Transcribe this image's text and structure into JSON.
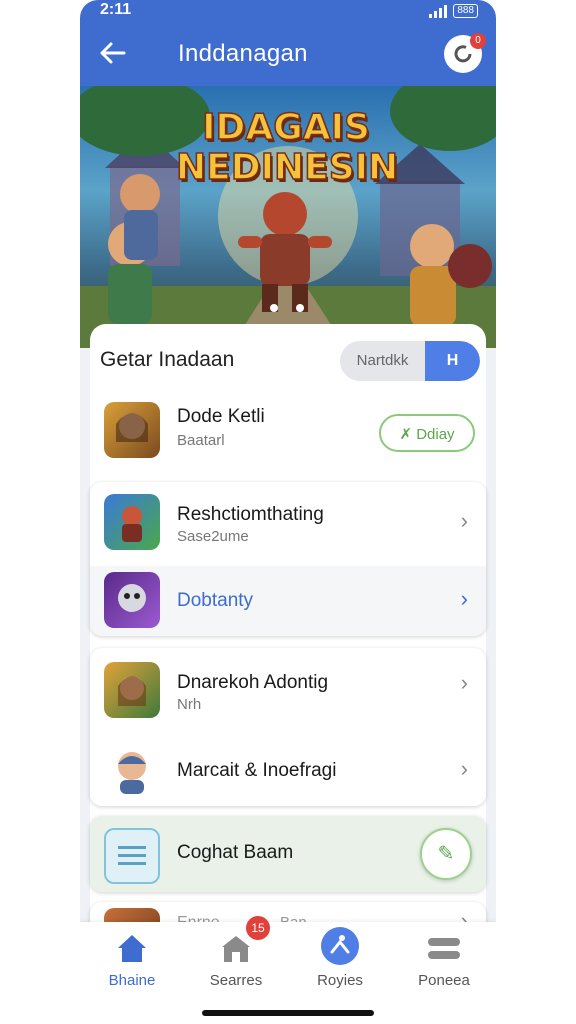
{
  "status": {
    "time": "2:11",
    "battery": "888"
  },
  "appbar": {
    "title": "Inddanagan",
    "notif_count": "0"
  },
  "hero": {
    "logo_line1": "IDAGAIS",
    "logo_line2": "NEDINESIN"
  },
  "section": {
    "title": "Getar Inadaan",
    "seg_left": "Nartdkk",
    "seg_right": "H"
  },
  "items": [
    {
      "name": "Dode Ketli",
      "sub": "Baatarl",
      "action": "Ddiay"
    },
    {
      "name": "Reshctiomthating",
      "sub": "Sase2ume"
    },
    {
      "name": "Dobtanty"
    },
    {
      "name": "Dnarekoh Adontig",
      "sub": "Nrh"
    },
    {
      "name": "Marcait & Inoefragi"
    },
    {
      "name": "Coghat Baam"
    },
    {
      "name": "Enrne",
      "sub2": "Ban"
    }
  ],
  "colors": {
    "primary": "#3f6ccf",
    "accent_green": "#5aa74a",
    "badge_red": "#e0413b",
    "active_tab": "#3f6ccf"
  },
  "nav": [
    {
      "label": "Bhaine",
      "icon": "home-icon"
    },
    {
      "label": "Searres",
      "icon": "store-icon",
      "badge": "15"
    },
    {
      "label": "Royies",
      "icon": "profile-icon"
    },
    {
      "label": "Poneea",
      "icon": "menu-icon"
    }
  ]
}
